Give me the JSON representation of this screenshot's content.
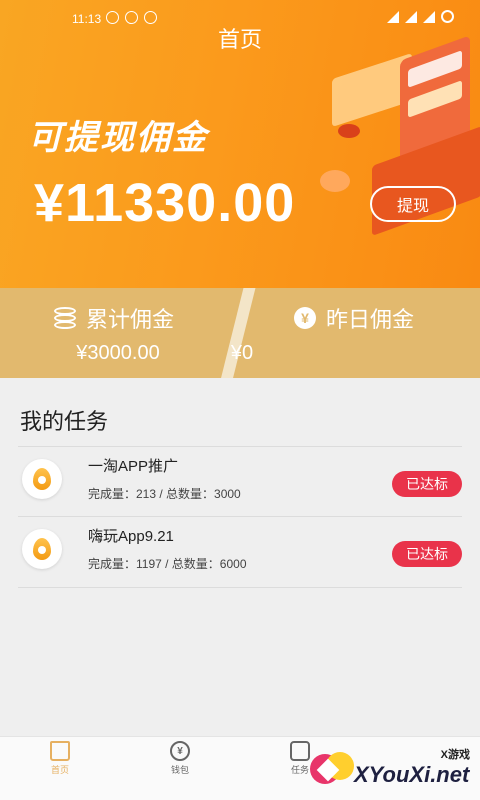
{
  "status_bar": {
    "time": "11:13"
  },
  "header": {
    "title": "首页",
    "withdraw_title": "可提现佣金",
    "balance": "¥11330.00",
    "withdraw_button": "提现"
  },
  "stats": {
    "total": {
      "label": "累计佣金",
      "value": "¥3000.00",
      "icon": "coins-icon"
    },
    "yesterday": {
      "label": "昨日佣金",
      "value": "¥0",
      "icon": "yen-icon"
    }
  },
  "tasks": {
    "title": "我的任务",
    "items": [
      {
        "name": "一淘APP推广",
        "progress": "完成量：213 / 总数量：3000",
        "badge": "已达标"
      },
      {
        "name": "嗨玩App9.21",
        "progress": "完成量：1197 / 总数量：6000",
        "badge": "已达标"
      }
    ]
  },
  "tabbar": {
    "items": [
      {
        "label": "首页",
        "icon": "home-icon",
        "active": true
      },
      {
        "label": "钱包",
        "icon": "wallet-icon",
        "active": false
      },
      {
        "label": "任务",
        "icon": "task-icon",
        "active": false
      }
    ]
  },
  "watermark": {
    "small": "X游戏",
    "big": "XYouXi.net"
  },
  "colors": {
    "accent": "#f9a623",
    "badge": "#e9334a",
    "stats": "#e2b96e"
  }
}
